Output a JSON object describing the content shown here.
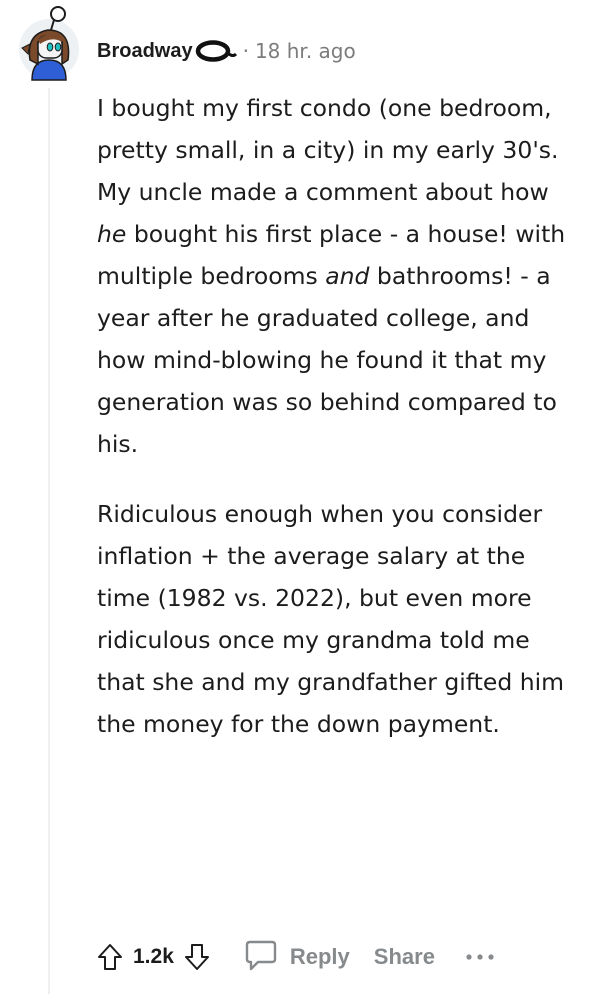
{
  "comment": {
    "username": "Broadway",
    "separator": "·",
    "timestamp": "18 hr. ago",
    "paragraphs": [
      [
        {
          "text": "I bought my first condo (one bedroom, pretty small, in a city) in my early 30's. My uncle made a comment about how "
        },
        {
          "text": "he",
          "italic": true
        },
        {
          "text": " bought his first place - a house! with multiple bedrooms "
        },
        {
          "text": "and",
          "italic": true
        },
        {
          "text": " bathrooms! - a year after he graduated college, and how mind-blowing he found it that my generation was so behind compared to his."
        }
      ],
      [
        {
          "text": "Ridiculous enough when you consider inflation + the average salary at the time (1982 vs. 2022), but even more ridiculous once my grandma told me that she and my grandfather gifted him the money for the down payment."
        }
      ]
    ]
  },
  "actions": {
    "score": "1.2k",
    "reply_label": "Reply",
    "share_label": "Share"
  },
  "icons": {
    "upvote": "arrow-up-icon",
    "downvote": "arrow-down-icon",
    "reply": "speech-bubble-icon",
    "more": "ellipsis-icon",
    "flair": "ring-icon"
  },
  "colors": {
    "text": "#1c1c1c",
    "muted": "#878a8c",
    "thread_line": "#edeff1"
  }
}
